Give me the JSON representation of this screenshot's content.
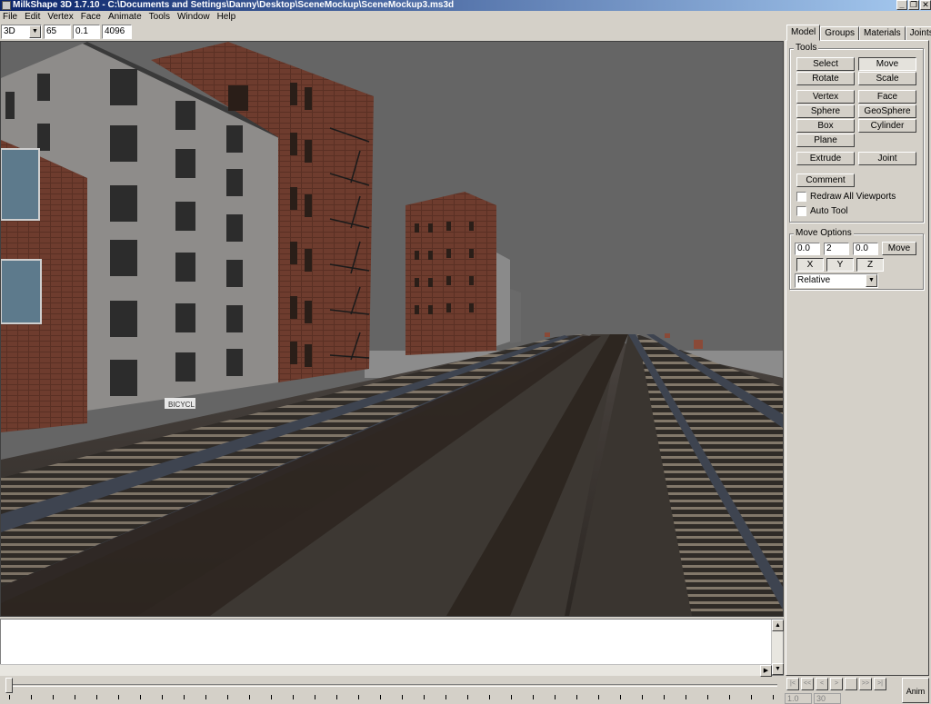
{
  "window": {
    "title": "MilkShape 3D 1.7.10 - C:\\Documents and Settings\\Danny\\Desktop\\SceneMockup\\SceneMockup3.ms3d",
    "minimize_icon": "_",
    "restore_icon": "❐",
    "close_icon": "✕"
  },
  "menu": [
    "File",
    "Edit",
    "Vertex",
    "Face",
    "Animate",
    "Tools",
    "Window",
    "Help"
  ],
  "toolbar": {
    "view_mode": "3D",
    "field1": "65",
    "field2": "0.1",
    "field3": "4096"
  },
  "tabs": [
    "Model",
    "Groups",
    "Materials",
    "Joints"
  ],
  "tools": {
    "label": "Tools",
    "select": "Select",
    "move": "Move",
    "rotate": "Rotate",
    "scale": "Scale",
    "vertex": "Vertex",
    "face": "Face",
    "sphere": "Sphere",
    "geosphere": "GeoSphere",
    "box": "Box",
    "cylinder": "Cylinder",
    "plane": "Plane",
    "extrude": "Extrude",
    "joint": "Joint",
    "comment": "Comment",
    "redraw_all": "Redraw All Viewports",
    "auto_tool": "Auto Tool"
  },
  "move_options": {
    "label": "Move Options",
    "x_value": "0.0",
    "y_value": "2",
    "z_value": "0.0",
    "move_button": "Move",
    "x_axis": "X",
    "y_axis": "Y",
    "z_axis": "Z",
    "mode": "Relative"
  },
  "animation": {
    "start_frame": "1.0",
    "end_frame": "30",
    "anim_button": "Anim",
    "buttons": [
      "|<",
      "<<",
      "<",
      ">",
      ">>",
      ">|",
      ""
    ]
  },
  "scene": {
    "sign_text": "BICYCL"
  }
}
